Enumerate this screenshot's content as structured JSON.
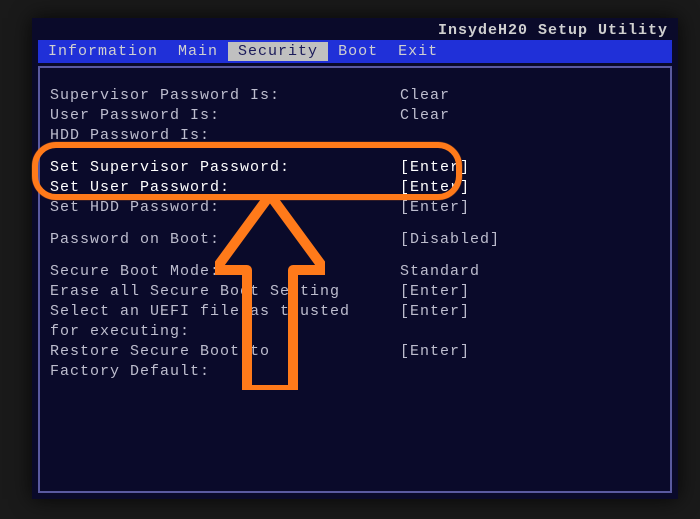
{
  "utility_name": "InsydeH20 Setup Utility",
  "tabs": [
    {
      "label": "Information",
      "active": false
    },
    {
      "label": "Main",
      "active": false
    },
    {
      "label": "Security",
      "active": true
    },
    {
      "label": "Boot",
      "active": false
    },
    {
      "label": "Exit",
      "active": false
    }
  ],
  "rows": [
    {
      "label": "Supervisor Password Is:",
      "value": "Clear",
      "interactable": false
    },
    {
      "label": "User Password Is:",
      "value": "Clear",
      "interactable": false
    },
    {
      "label": "HDD Password Is:",
      "value": "",
      "interactable": false
    },
    {
      "gap": true
    },
    {
      "label": "Set Supervisor Password:",
      "value": "[Enter]",
      "interactable": true,
      "highlight": true
    },
    {
      "label": "Set User Password:",
      "value": "[Enter]",
      "interactable": true,
      "highlight": true
    },
    {
      "label": "Set HDD Password:",
      "value": "[Enter]",
      "interactable": true
    },
    {
      "gap": true
    },
    {
      "label": "Password on Boot:",
      "value": "[Disabled]",
      "interactable": true
    },
    {
      "gap": true
    },
    {
      "label": "Secure Boot Mode:",
      "value": "Standard",
      "interactable": false
    },
    {
      "label": "Erase all Secure Boot Setting",
      "value": "[Enter]",
      "interactable": true
    },
    {
      "label": "Select an UEFI file as trusted",
      "value": "[Enter]",
      "interactable": true
    },
    {
      "label": "for executing:",
      "value": "",
      "interactable": false
    },
    {
      "label": "Restore Secure Boot to",
      "value": "[Enter]",
      "interactable": true
    },
    {
      "label": "Factory Default:",
      "value": "",
      "interactable": false
    }
  ],
  "annotation": {
    "highlight_color": "#ff7a1a"
  }
}
